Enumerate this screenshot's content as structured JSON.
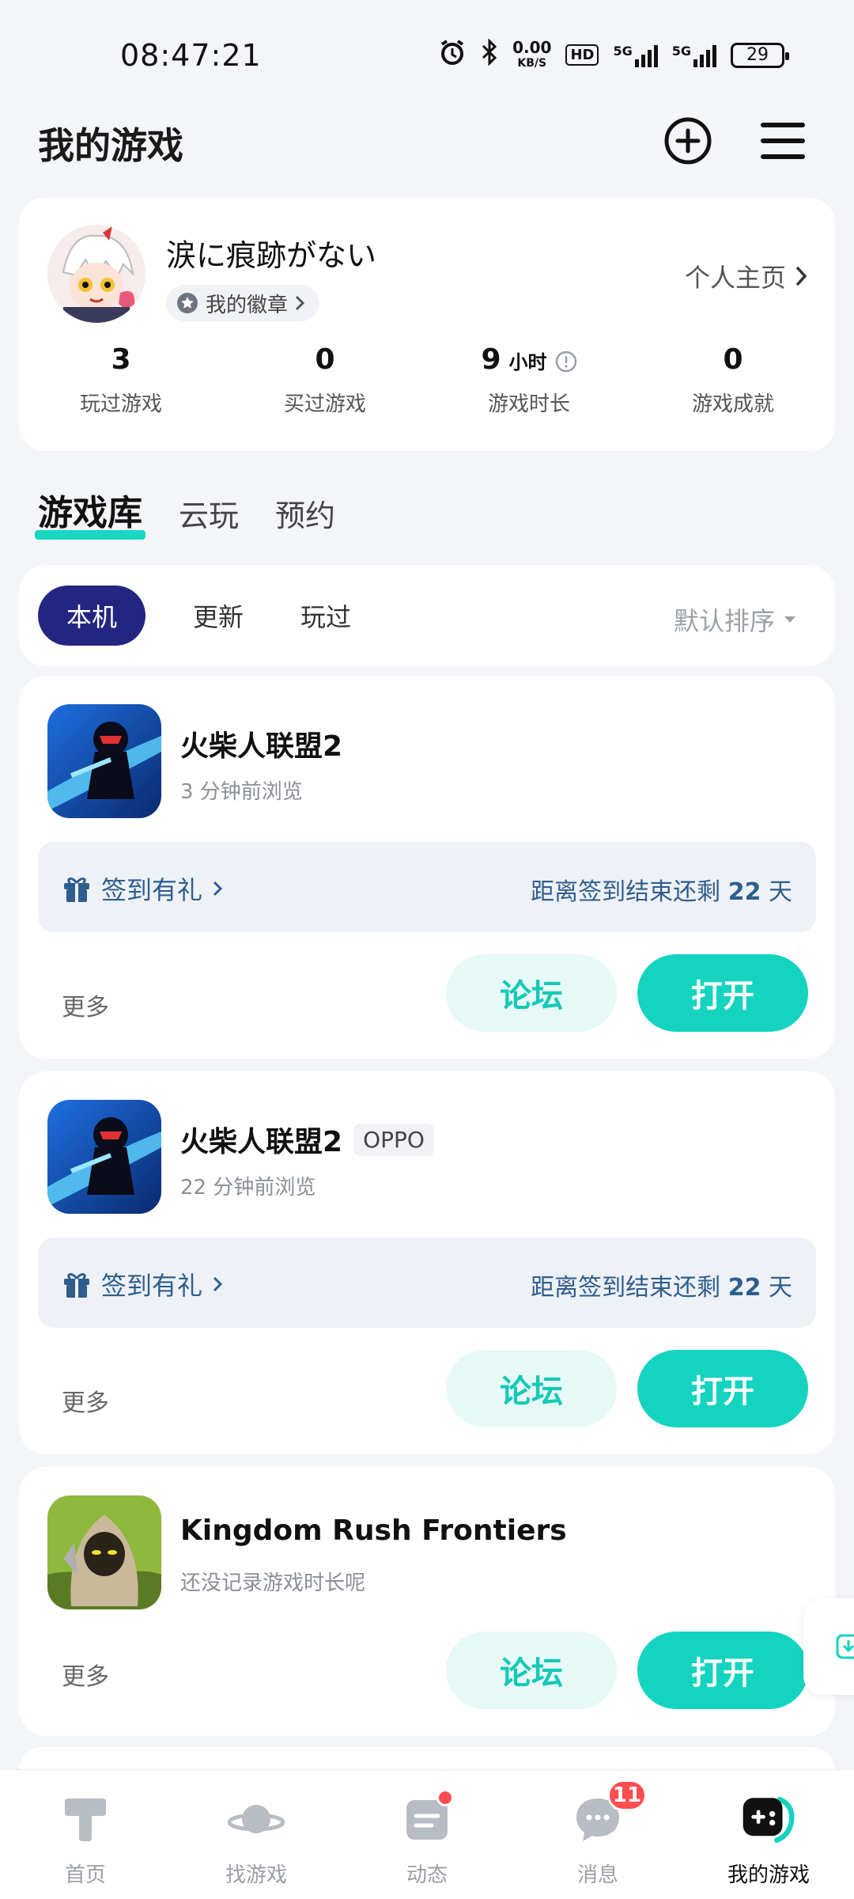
{
  "status_bar": {
    "time": "08:47:21",
    "net_speed_value": "0.00",
    "net_speed_unit": "KB/S",
    "hd_label": "HD",
    "signal1": "5G",
    "signal2": "5G",
    "battery": "29"
  },
  "header": {
    "title": "我的游戏"
  },
  "profile": {
    "username": "涙に痕跡がない",
    "badge_label": "我的徽章",
    "homepage_link": "个人主页",
    "stats": [
      {
        "value": "3",
        "unit": "",
        "label": "玩过游戏"
      },
      {
        "value": "0",
        "unit": "",
        "label": "买过游戏"
      },
      {
        "value": "9",
        "unit": "小时",
        "label": "游戏时长"
      },
      {
        "value": "0",
        "unit": "",
        "label": "游戏成就"
      }
    ]
  },
  "tabs": [
    {
      "label": "游戏库",
      "active": true
    },
    {
      "label": "云玩",
      "active": false
    },
    {
      "label": "预约",
      "active": false
    }
  ],
  "filter": {
    "chips": [
      "本机",
      "更新",
      "玩过"
    ],
    "sort_label": "默认排序"
  },
  "games": [
    {
      "name": "火柴人联盟2",
      "tag": "",
      "subtitle": "3 分钟前浏览",
      "signin_label": "签到有礼",
      "signin_remaining_prefix": "距离签到结束还剩",
      "signin_days": "22",
      "signin_unit": "天",
      "more": "更多",
      "forum": "论坛",
      "open": "打开"
    },
    {
      "name": "火柴人联盟2",
      "tag": "OPPO",
      "subtitle": "22 分钟前浏览",
      "signin_label": "签到有礼",
      "signin_remaining_prefix": "距离签到结束还剩",
      "signin_days": "22",
      "signin_unit": "天",
      "more": "更多",
      "forum": "论坛",
      "open": "打开"
    },
    {
      "name": "Kingdom Rush Frontiers",
      "tag": "",
      "subtitle": "还没记录游戏时长呢",
      "more": "更多",
      "forum": "论坛",
      "open": "打开"
    }
  ],
  "bottom_nav": [
    {
      "label": "首页",
      "icon": "home-icon"
    },
    {
      "label": "找游戏",
      "icon": "planet-icon"
    },
    {
      "label": "动态",
      "icon": "feed-icon"
    },
    {
      "label": "消息",
      "icon": "message-icon",
      "badge": "11"
    },
    {
      "label": "我的游戏",
      "icon": "gamepad-icon",
      "active": true
    }
  ],
  "colors": {
    "accent": "#14D4C0",
    "chip_active": "#222680",
    "signin_text": "#2E5E8E",
    "badge_red": "#FF4D4F"
  }
}
